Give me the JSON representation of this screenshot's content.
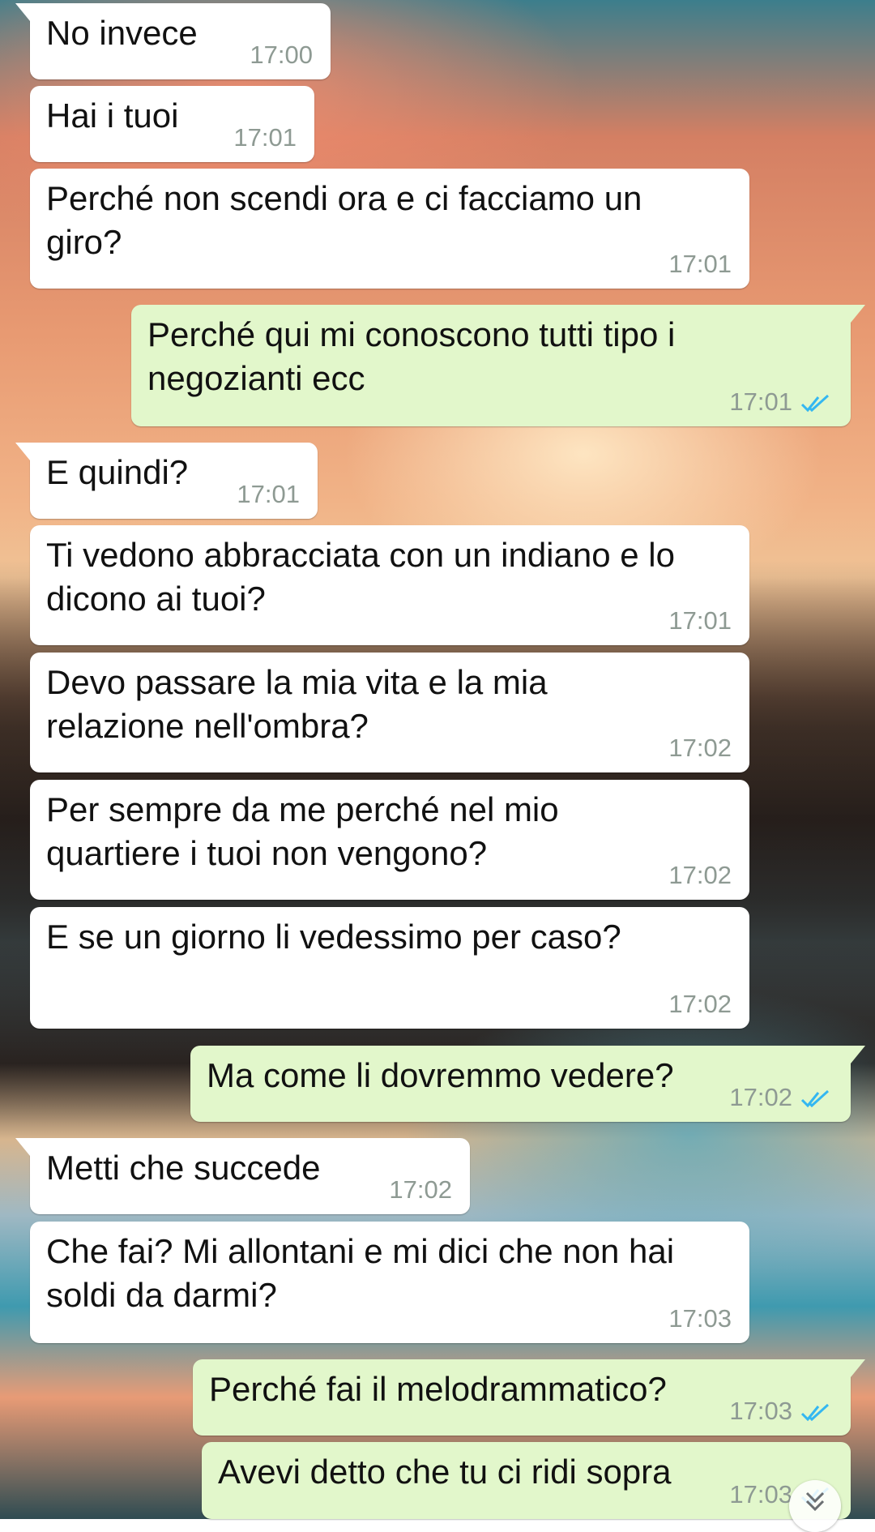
{
  "colors": {
    "incoming_bubble": "#ffffff",
    "outgoing_bubble": "#e2f7cb",
    "timestamp": "#8e9a93",
    "read_ticks": "#34b7f1"
  },
  "messages": [
    {
      "direction": "in",
      "text_lines": [
        "No invece"
      ],
      "time": "17:00"
    },
    {
      "direction": "in",
      "text_lines": [
        "Hai i tuoi"
      ],
      "time": "17:01"
    },
    {
      "direction": "in",
      "text_lines": [
        "Perché non scendi ora e ci facciamo un",
        "giro?"
      ],
      "time": "17:01"
    },
    {
      "direction": "out",
      "text_lines": [
        "Perché qui mi conoscono tutti tipo i",
        "negozianti ecc"
      ],
      "time": "17:01",
      "status": "read"
    },
    {
      "direction": "in",
      "text_lines": [
        "E quindi?"
      ],
      "time": "17:01"
    },
    {
      "direction": "in",
      "text_lines": [
        "Ti vedono abbracciata con un indiano e lo",
        "dicono ai tuoi?"
      ],
      "time": "17:01"
    },
    {
      "direction": "in",
      "text_lines": [
        "Devo passare la mia vita e la mia",
        "relazione nell'ombra?"
      ],
      "time": "17:02"
    },
    {
      "direction": "in",
      "text_lines": [
        "Per sempre da me perché nel mio",
        "quartiere i tuoi non vengono?"
      ],
      "time": "17:02"
    },
    {
      "direction": "in",
      "text_lines": [
        "E se un giorno li vedessimo per caso?"
      ],
      "time": "17:02"
    },
    {
      "direction": "out",
      "text_lines": [
        "Ma come li dovremmo vedere?"
      ],
      "time": "17:02",
      "status": "read"
    },
    {
      "direction": "in",
      "text_lines": [
        "Metti che succede"
      ],
      "time": "17:02"
    },
    {
      "direction": "in",
      "text_lines": [
        "Che fai? Mi allontani e mi dici che non hai",
        "soldi da darmi?"
      ],
      "time": "17:03"
    },
    {
      "direction": "out",
      "text_lines": [
        "Perché fai il melodrammatico?"
      ],
      "time": "17:03",
      "status": "read"
    },
    {
      "direction": "out",
      "text_lines": [
        "Avevi detto che tu ci ridi sopra"
      ],
      "time": "17:03",
      "status": "read"
    }
  ]
}
